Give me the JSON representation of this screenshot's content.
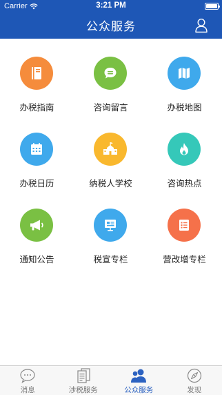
{
  "status_bar": {
    "carrier": "Carrier",
    "time": "3:21 PM"
  },
  "header": {
    "title": "公众服务",
    "user_icon": "user-icon"
  },
  "colors": {
    "header": "#1e57b6",
    "tab_active": "#2c62c1"
  },
  "grid": {
    "items": [
      {
        "label": "办税指南",
        "icon": "book-icon",
        "color": "#f58c3c"
      },
      {
        "label": "咨询留言",
        "icon": "chat-icon",
        "color": "#7ac043"
      },
      {
        "label": "办税地图",
        "icon": "map-icon",
        "color": "#3fa9ec"
      },
      {
        "label": "办税日历",
        "icon": "calendar-icon",
        "color": "#3fa9ec"
      },
      {
        "label": "纳税人学校",
        "icon": "school-icon",
        "color": "#f9b82e"
      },
      {
        "label": "咨询热点",
        "icon": "flame-icon",
        "color": "#35c8b9"
      },
      {
        "label": "通知公告",
        "icon": "megaphone-icon",
        "color": "#7ac043"
      },
      {
        "label": "税宣专栏",
        "icon": "presentation-icon",
        "color": "#3fa9ec"
      },
      {
        "label": "营改增专栏",
        "icon": "list-icon",
        "color": "#f5714a"
      }
    ]
  },
  "tabbar": {
    "tabs": [
      {
        "label": "消息",
        "icon": "message-icon",
        "active": false
      },
      {
        "label": "涉税服务",
        "icon": "documents-icon",
        "active": false
      },
      {
        "label": "公众服务",
        "icon": "people-icon",
        "active": true
      },
      {
        "label": "发现",
        "icon": "compass-icon",
        "active": false
      }
    ]
  }
}
